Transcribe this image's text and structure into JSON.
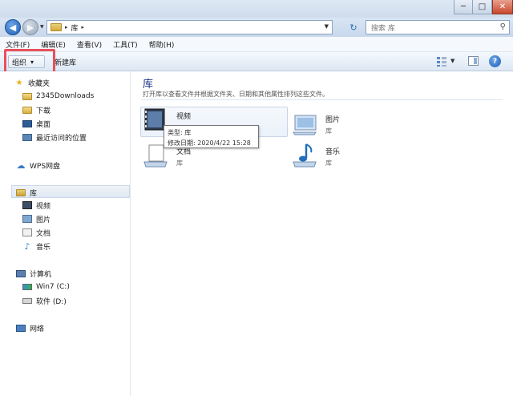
{
  "window": {
    "controls": {
      "minimize": "─",
      "maximize": "□",
      "close": "✕"
    }
  },
  "address_bar": {
    "separator": "▸",
    "location": "库",
    "search_placeholder": "搜索 库"
  },
  "menu": [
    "文件(F)",
    "编辑(E)",
    "查看(V)",
    "工具(T)",
    "帮助(H)"
  ],
  "command_bar": {
    "organize_label": "组织",
    "organize_arrow": "▾",
    "new_library_label": "新建库",
    "help_icon_text": "?"
  },
  "nav_pane": {
    "favorites": {
      "label": "收藏夹",
      "items": [
        "2345Downloads",
        "下载",
        "桌面",
        "最近访问的位置"
      ]
    },
    "wps": "WPS网盘",
    "libraries": {
      "label": "库",
      "items": [
        "视频",
        "图片",
        "文档",
        "音乐"
      ]
    },
    "computer": {
      "label": "计算机",
      "items": [
        "Win7 (C:)",
        "软件 (D:)"
      ]
    },
    "network": "网络"
  },
  "content": {
    "title": "库",
    "description": "打开库以查看文件并根据文件夹、日期和其他属性排列这些文件。",
    "libraries": [
      {
        "name": "视频",
        "type": "库"
      },
      {
        "name": "图片",
        "type": "库"
      },
      {
        "name": "文档",
        "type": "库"
      },
      {
        "name": "音乐",
        "type": "库"
      }
    ],
    "tooltip": {
      "type_line": "类型: 库",
      "modified_line": "修改日期: 2020/4/22 15:28"
    }
  },
  "colors": {
    "highlight": "#e8505b",
    "title_blue": "#1e3287"
  }
}
